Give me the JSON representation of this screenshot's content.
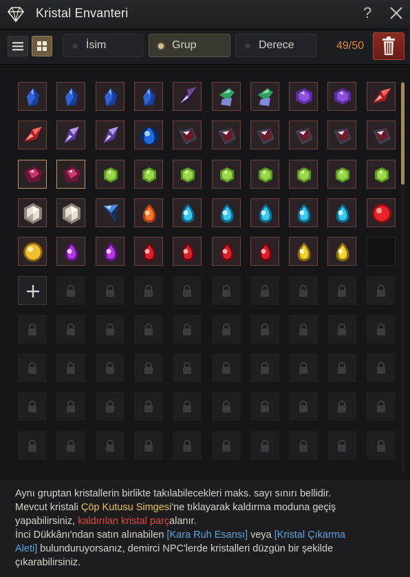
{
  "window": {
    "title": "Kristal Envanteri",
    "help_label": "?"
  },
  "toolbar": {
    "sort_options": [
      {
        "label": "İsim",
        "selected": false
      },
      {
        "label": "Grup",
        "selected": true
      },
      {
        "label": "Derece",
        "selected": false
      }
    ],
    "count_current": "49",
    "count_sep": "/",
    "count_max": "50"
  },
  "colors": {
    "accent": "#d8c184",
    "count": "#e08a3a",
    "trash": "#7a241c"
  },
  "grid": {
    "columns": 10,
    "rows": [
      [
        "sapphire",
        "sapphire",
        "sapphire",
        "sapphire",
        "dark-diamond",
        "emerald-shard",
        "emerald-shard",
        "amethyst-hex",
        "amethyst-hex",
        "ruby-shard"
      ],
      [
        "ruby-shard",
        "violet-shard",
        "violet-shard",
        "blue-drop",
        "dark-crimson",
        "dark-crimson",
        "dark-crimson",
        "dark-crimson",
        "dark-crimson",
        "dark-crimson"
      ],
      [
        "crimson-gem",
        "crimson-gem",
        "green-orb",
        "green-orb",
        "green-orb",
        "green-orb",
        "green-orb",
        "green-orb",
        "green-orb",
        "green-orb"
      ],
      [
        "white-hex",
        "white-hex",
        "blue-diamond",
        "orange-drop",
        "cyan-drop",
        "cyan-drop",
        "cyan-drop",
        "cyan-drop",
        "cyan-drop",
        "red-orb"
      ],
      [
        "gold-orb",
        "purple-drop",
        "purple-drop",
        "red-drop",
        "red-drop",
        "red-drop",
        "red-drop",
        "yellow-drop",
        "yellow-drop",
        "empty"
      ]
    ],
    "gold_bordered": [
      [
        2,
        0
      ],
      [
        2,
        1
      ]
    ],
    "locked_rows": 5
  },
  "info": {
    "line1": "Aynı gruptan kristallerin birlikte takılabilecekleri maks. sayı sınırı bellidir.",
    "line2a": "Mevcut kristali ",
    "line2b": "Çöp Kutusu Simgesi",
    "line2c": "'ne tıklayarak kaldırma moduna geçiş",
    "line3a": "yapabilirsiniz, ",
    "line3b": "kaldırılan kristal parç",
    "line3c": "alanır.",
    "line4a": "İnci Dükkânı'ndan satın alınabilen ",
    "line4b": "[Kara Ruh Esansı]",
    "line4c": " veya ",
    "line4d": "[Kristal Çıkarma",
    "line5a": "Aleti]",
    "line5b": " bulunduruyorsanız, demirci NPC'lerde kristalleri düzgün bir şekilde",
    "line6": "çıkarabilirsiniz."
  }
}
